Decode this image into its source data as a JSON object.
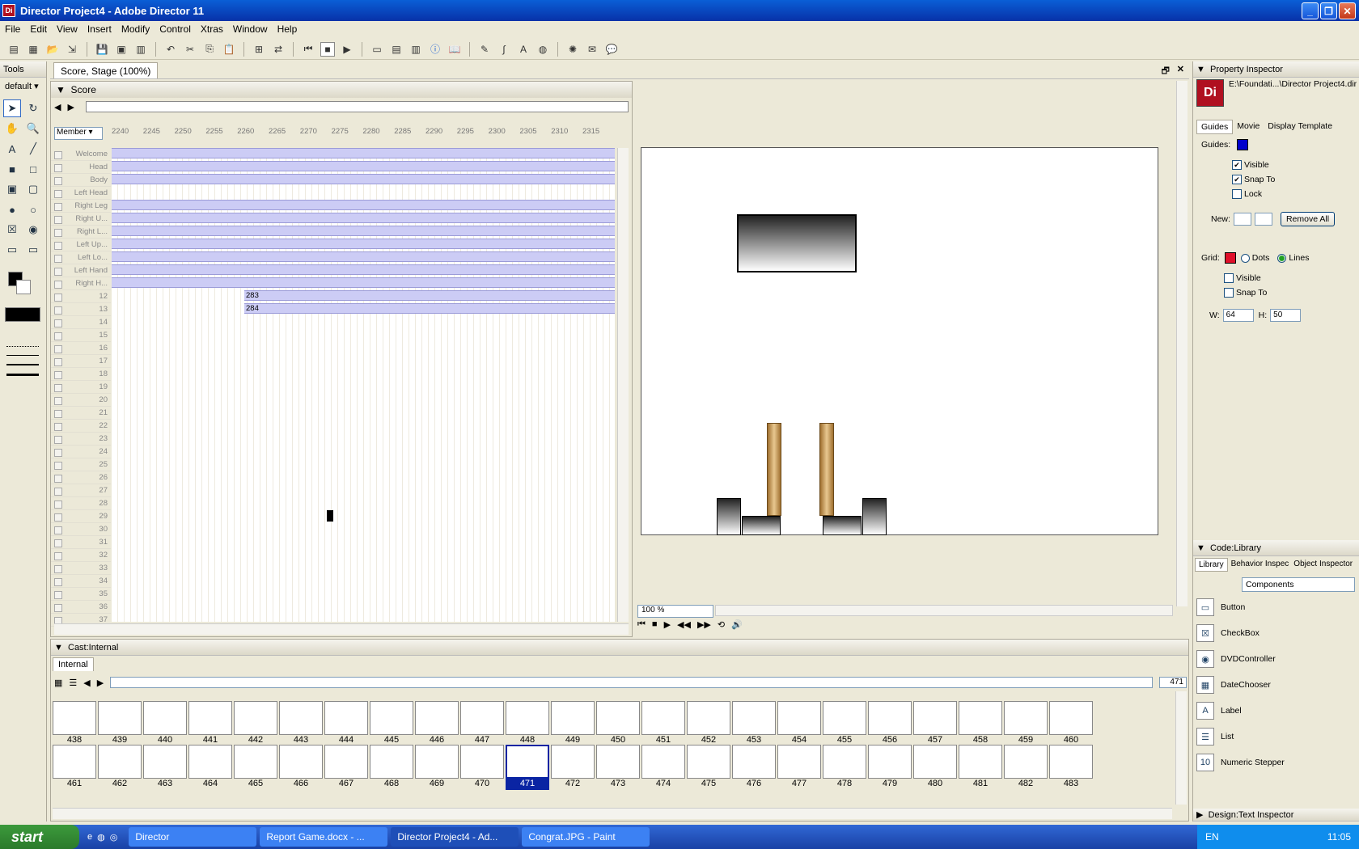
{
  "window": {
    "title": "Director Project4 - Adobe Director 11",
    "app_icon": "Di"
  },
  "menu": [
    "File",
    "Edit",
    "View",
    "Insert",
    "Modify",
    "Control",
    "Xtras",
    "Window",
    "Help"
  ],
  "tools": {
    "title": "Tools",
    "preset": "default"
  },
  "doc_tab": "Score, Stage (100%)",
  "score": {
    "title": "Score",
    "member_select": "Member",
    "frame_numbers": [
      "2240",
      "2245",
      "2250",
      "2255",
      "2260",
      "2265",
      "2270",
      "2275",
      "2280",
      "2285",
      "2290",
      "2295",
      "2300",
      "2305",
      "2310",
      "2315"
    ],
    "channels": [
      "Welcome",
      "Head",
      "Body",
      "Left Head",
      "Right Leg",
      "Right U...",
      "Right L...",
      "Left Up...",
      "Left Lo...",
      "Left Hand",
      "Right H...",
      "12",
      "13",
      "14",
      "15",
      "16",
      "17",
      "18",
      "19",
      "20",
      "21",
      "22",
      "23",
      "24",
      "25",
      "26",
      "27",
      "28",
      "29",
      "30",
      "31",
      "32",
      "33",
      "34",
      "35",
      "36",
      "37"
    ],
    "sprite_labels": [
      "283",
      "284"
    ]
  },
  "stage": {
    "zoom": "100 %"
  },
  "cast": {
    "title": "Cast:Internal",
    "tab": "Internal",
    "selected_number": "471",
    "row1": [
      "438",
      "439",
      "440",
      "441",
      "442",
      "443",
      "444",
      "445",
      "446",
      "447",
      "448",
      "449",
      "450",
      "451",
      "452",
      "453",
      "454",
      "455",
      "456",
      "457",
      "458",
      "459",
      "460"
    ],
    "row2": [
      "461",
      "462",
      "463",
      "464",
      "465",
      "466",
      "467",
      "468",
      "469",
      "470",
      "471",
      "472",
      "473",
      "474",
      "475",
      "476",
      "477",
      "478",
      "479",
      "480",
      "481",
      "482",
      "483"
    ]
  },
  "property_inspector": {
    "title": "Property Inspector",
    "path": "E:\\Foundati...\\Director Project4.dir",
    "tabs": [
      "Guides",
      "Movie",
      "Display Template"
    ],
    "guides_label": "Guides:",
    "guides_color": "#0000cc",
    "visible": "Visible",
    "snap_to": "Snap To",
    "lock": "Lock",
    "new_label": "New:",
    "remove_all": "Remove All",
    "grid_label": "Grid:",
    "grid_color": "#e0102a",
    "dots": "Dots",
    "lines": "Lines",
    "grid_visible": "Visible",
    "grid_snap": "Snap To",
    "w_label": "W:",
    "w_value": "64",
    "h_label": "H:",
    "h_value": "50"
  },
  "library": {
    "title": "Code:Library",
    "tabs": [
      "Library",
      "Behavior Inspec",
      "Object Inspector"
    ],
    "category": "Components",
    "items": [
      "Button",
      "CheckBox",
      "DVDController",
      "DateChooser",
      "Label",
      "List",
      "Numeric Stepper"
    ]
  },
  "design_panel": "Design:Text Inspector",
  "taskbar": {
    "start": "start",
    "tasks": [
      "Director",
      "Report Game.docx - ...",
      "Director Project4 - Ad...",
      "Congrat.JPG - Paint"
    ],
    "lang": "EN",
    "clock": "11:05"
  }
}
